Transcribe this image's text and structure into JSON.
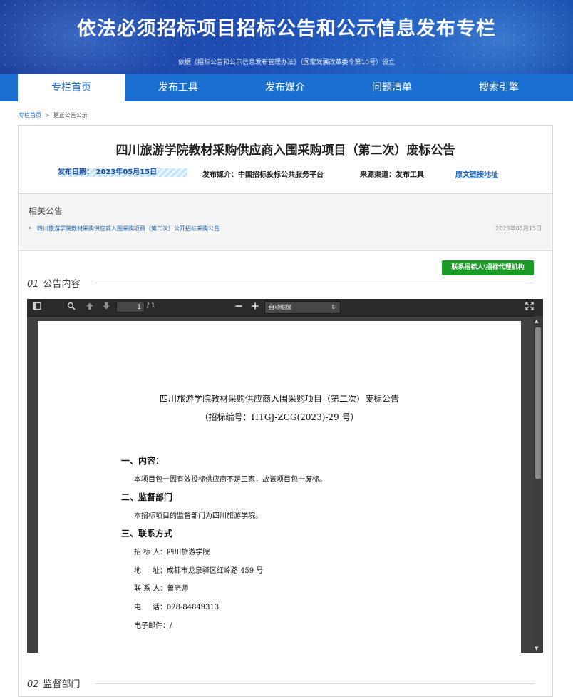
{
  "banner": {
    "title": "依法必须招标项目招标公告和公示信息发布专栏",
    "subtitle": "依据《招标公告和公示信息发布管理办法》（国家发展改革委令第10号）设立"
  },
  "nav": {
    "items": [
      {
        "label": "专栏首页"
      },
      {
        "label": "发布工具"
      },
      {
        "label": "发布媒介"
      },
      {
        "label": "问题清单"
      },
      {
        "label": "搜索引擎"
      }
    ]
  },
  "breadcrumb": {
    "home": "专栏首页",
    "separator": ">",
    "current": "更正公告公示"
  },
  "notice": {
    "title": "四川旅游学院教材采购供应商入围采购项目（第二次）废标公告",
    "publish_date": "发布日期： 2023年05月15日",
    "media": "发布媒介：中国招标投标公共服务平台",
    "channel": "来源渠道：发布工具",
    "source_link": "原文链接地址"
  },
  "related": {
    "heading": "相关公告",
    "items": [
      {
        "title": "四川旅游学院教材采购供应商入围采购项目（第二次）公开招标采购公告",
        "date": "2023年05月15日"
      }
    ]
  },
  "contact_button": "联系招标人\\招标代理机构",
  "sections": [
    {
      "num": "01",
      "label": "公告内容"
    },
    {
      "num": "02",
      "label": "监督部门"
    }
  ],
  "viewer": {
    "page_current": "1",
    "page_total": "/ 1",
    "zoom": "自动缩放",
    "icons": [
      "sidebar-toggle-icon",
      "search-icon",
      "page-up-icon",
      "page-down-icon",
      "zoom-out-icon",
      "zoom-in-icon",
      "fullscreen-icon"
    ]
  },
  "document": {
    "title": "四川旅游学院教材采购供应商入围采购项目（第二次）废标公告",
    "code": "（招标编号：HTGJ-ZCG(2023)-29 号）",
    "h1": "一、内容：",
    "p1": "本项目包一因有效投标供应商不足三家，故该项目包一废标。",
    "h2": "二、监督部门",
    "p2": "本招标项目的监督部门为四川旅游学院。",
    "h3": "三、联系方式",
    "tenderer": "招 标 人：四川旅游学院",
    "address": "地     址：成都市龙泉驿区红岭路 459 号",
    "contact": "联 系 人：曾老师",
    "phone": "电     话：028-84849313",
    "email": "电子邮件：/"
  },
  "colors": {
    "nav_bg": "#1a6fd0",
    "button_green": "#1b9b26",
    "link_blue": "#1a5fb0"
  }
}
